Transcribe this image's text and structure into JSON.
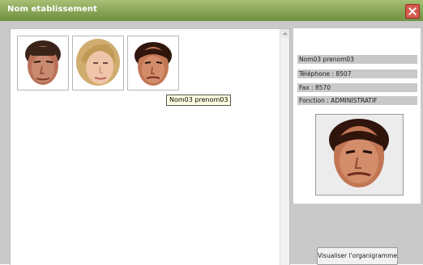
{
  "window": {
    "title": "Nom etablissement"
  },
  "tooltip": "Nom03 prenom03",
  "details": {
    "name": "Nom03 prenom03",
    "phone": "Téléphone : 8507",
    "fax": "Fax : 8570",
    "role": "Fonction : ADMINISTRATIF"
  },
  "buttons": {
    "org_chart": "Visualiser l'organigramme"
  },
  "icons": {
    "close": "close-icon",
    "scroll_up": "scroll-up-arrow-icon"
  },
  "colors": {
    "titlebar": "#7f9f4a",
    "close": "#d65a4e",
    "tooltip_bg": "#ffffe1",
    "label_bg": "#c9c9c9"
  }
}
